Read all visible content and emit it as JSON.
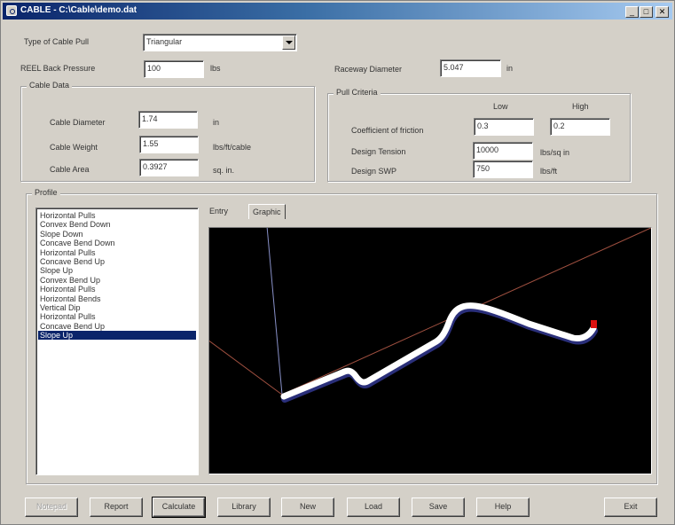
{
  "window": {
    "title": "CABLE - C:\\Cable\\demo.dat",
    "min_symbol": "_",
    "max_symbol": "□",
    "close_symbol": "✕"
  },
  "form": {
    "pull_type_label": "Type of Cable Pull",
    "pull_type_value": "Triangular",
    "reel_label": "REEL Back Pressure",
    "reel_value": "100",
    "reel_unit": "lbs",
    "raceway_label": "Raceway Diameter",
    "raceway_value": "5.047",
    "raceway_unit": "in"
  },
  "cable_data": {
    "title": "Cable Data",
    "diameter_label": "Cable Diameter",
    "diameter_value": "1.74",
    "diameter_unit": "in",
    "weight_label": "Cable Weight",
    "weight_value": "1.55",
    "weight_unit": "lbs/ft/cable",
    "area_label": "Cable Area",
    "area_value": "0.3927",
    "area_unit": "sq. in."
  },
  "pull_criteria": {
    "title": "Pull Criteria",
    "low_label": "Low",
    "high_label": "High",
    "friction_label": "Coefficient of friction",
    "friction_low": "0.3",
    "friction_high": "0.2",
    "tension_label": "Design Tension",
    "tension_value": "10000",
    "tension_unit": "lbs/sq in",
    "swp_label": "Design SWP",
    "swp_value": "750",
    "swp_unit": "lbs/ft"
  },
  "profile": {
    "title": "Profile",
    "items": [
      "Horizontal Pulls",
      "Convex Bend Down",
      "Slope Down",
      "Concave Bend Down",
      "Horizontal Pulls",
      "Concave Bend Up",
      "Slope Up",
      "Convex Bend Up",
      "Horizontal Pulls",
      "Horizontal Bends",
      "Vertical Dip",
      "Horizontal Pulls",
      "Concave Bend Up",
      "Slope Up"
    ],
    "selected_index": 13,
    "tabs": [
      "Entry",
      "Graphic"
    ],
    "active_tab": "Graphic"
  },
  "buttons": {
    "notepad": "Notepad",
    "report": "Report",
    "calculate": "Calculate",
    "library": "Library",
    "new": "New",
    "load": "Load",
    "save": "Save",
    "help": "Help",
    "exit": "Exit"
  },
  "colors": {
    "titlebar": "#0a246a",
    "cable": "#ffffff",
    "cable_end": "#dd1111",
    "axis_blue": "#8890c8",
    "axis_red": "#a05040"
  }
}
